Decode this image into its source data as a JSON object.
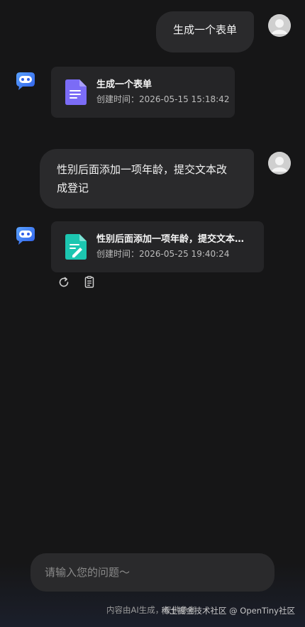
{
  "conversation": {
    "messages": [
      {
        "role": "user",
        "text": "生成一个表单"
      },
      {
        "role": "bot",
        "card": {
          "title": "生成一个表单",
          "time_label": "创建时间：2026-05-15 15:18:42",
          "icon": "document-icon",
          "icon_color": "#7B6CF6"
        }
      },
      {
        "role": "user",
        "text": "性别后面添加一项年龄，提交文本改成登记"
      },
      {
        "role": "bot",
        "card": {
          "title": "性别后面添加一项年龄，提交文本改成登记",
          "time_label": "创建时间：2026-05-25 19:40:24",
          "icon": "form-edit-icon",
          "icon_color": "#1CC6B0"
        }
      }
    ],
    "actions": [
      {
        "name": "regenerate-icon"
      },
      {
        "name": "copy-icon"
      }
    ]
  },
  "input": {
    "placeholder": "请输入您的问题～",
    "value": ""
  },
  "footer": {
    "disclaimer": "内容由AI生成，仅供参考",
    "watermark": "稀土掘金技术社区 @ OpenTiny社区"
  },
  "colors": {
    "background": "#161617",
    "bubble": "#2a2a2c",
    "card": "#252527",
    "bot_accent": "#3b7cf5"
  }
}
